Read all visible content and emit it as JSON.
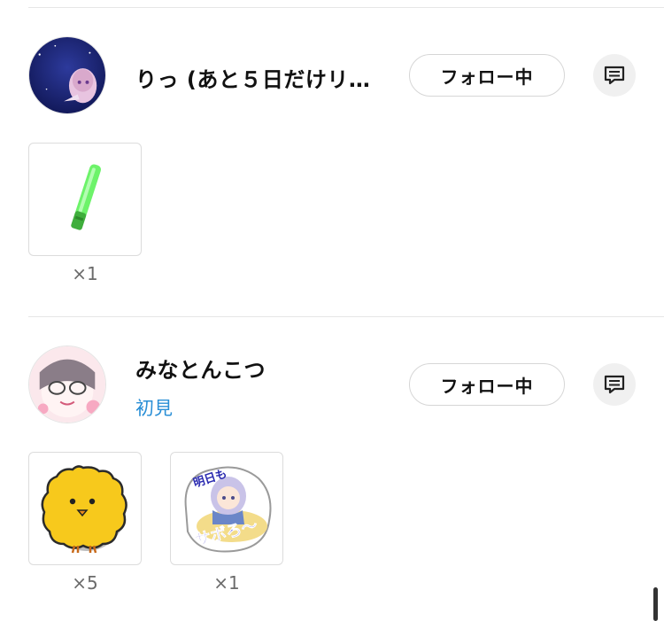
{
  "entries": [
    {
      "username": "りっ (あと５日だけリ…",
      "follow_label": "フォロー中",
      "gifts": [
        {
          "name": "penlight",
          "count": "×1",
          "color": "#4cd94a"
        }
      ]
    },
    {
      "username": "みなとんこつ",
      "subtag": "初見",
      "follow_label": "フォロー中",
      "gifts": [
        {
          "name": "chick",
          "count": "×5",
          "color": "#f7c91c"
        },
        {
          "name": "sticker-chibi",
          "count": "×1",
          "sticker_text_top": "明日も",
          "sticker_text_bottom": "サボろ〜"
        }
      ]
    }
  ],
  "icons": {
    "message": "message-icon"
  },
  "colors": {
    "accent": "#2a8fd6",
    "border": "#dcdcdc"
  }
}
